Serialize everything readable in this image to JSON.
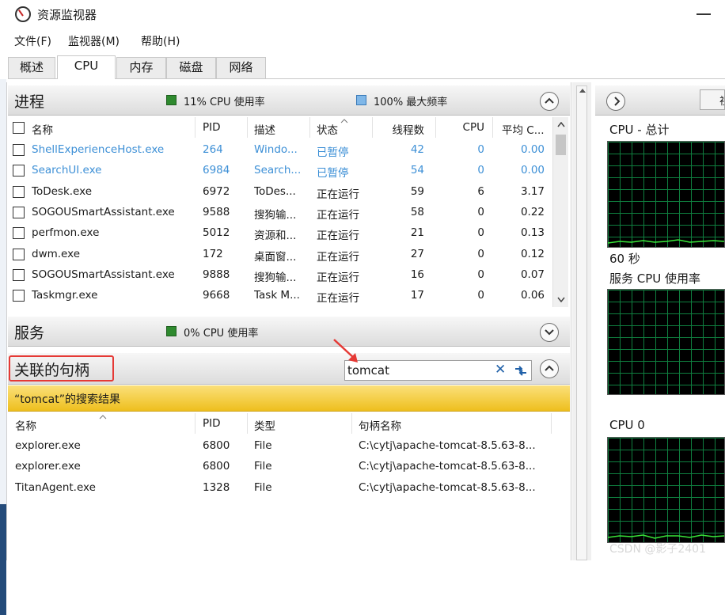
{
  "app": {
    "title": "资源监视器",
    "icon": "resource-monitor-icon"
  },
  "menu": [
    "文件(F)",
    "监视器(M)",
    "帮助(H)"
  ],
  "tabs": [
    "概述",
    "CPU",
    "内存",
    "磁盘",
    "网络"
  ],
  "active_tab": "CPU",
  "processes": {
    "title": "进程",
    "cpu_usage": "11% CPU 使用率",
    "max_freq": "100% 最大频率",
    "columns": [
      "名称",
      "PID",
      "描述",
      "状态",
      "线程数",
      "CPU",
      "平均 C..."
    ],
    "rows": [
      {
        "name": "ShellExperienceHost.exe",
        "pid": "264",
        "desc": "Windo...",
        "status": "已暂停",
        "threads": "42",
        "cpu": "0",
        "avg": "0.00"
      },
      {
        "name": "SearchUI.exe",
        "pid": "6984",
        "desc": "Search...",
        "status": "已暂停",
        "threads": "54",
        "cpu": "0",
        "avg": "0.00"
      },
      {
        "name": "ToDesk.exe",
        "pid": "6972",
        "desc": "ToDes...",
        "status": "正在运行",
        "threads": "59",
        "cpu": "6",
        "avg": "3.17"
      },
      {
        "name": "SOGOUSmartAssistant.exe",
        "pid": "9588",
        "desc": "搜狗输...",
        "status": "正在运行",
        "threads": "58",
        "cpu": "0",
        "avg": "0.22"
      },
      {
        "name": "perfmon.exe",
        "pid": "5012",
        "desc": "资源和...",
        "status": "正在运行",
        "threads": "21",
        "cpu": "0",
        "avg": "0.13"
      },
      {
        "name": "dwm.exe",
        "pid": "172",
        "desc": "桌面窗...",
        "status": "正在运行",
        "threads": "27",
        "cpu": "0",
        "avg": "0.12"
      },
      {
        "name": "SOGOUSmartAssistant.exe",
        "pid": "9888",
        "desc": "搜狗输...",
        "status": "正在运行",
        "threads": "16",
        "cpu": "0",
        "avg": "0.07"
      },
      {
        "name": "Taskmgr.exe",
        "pid": "9668",
        "desc": "Task M...",
        "status": "正在运行",
        "threads": "17",
        "cpu": "0",
        "avg": "0.06"
      }
    ]
  },
  "services": {
    "title": "服务",
    "cpu_usage": "0% CPU 使用率"
  },
  "handles": {
    "title": "关联的句柄",
    "search_value": "tomcat",
    "result_label": "“tomcat”的搜索结果",
    "columns": [
      "名称",
      "PID",
      "类型",
      "句柄名称"
    ],
    "rows": [
      {
        "name": "explorer.exe",
        "pid": "6800",
        "type": "File",
        "handle": "C:\\cytj\\apache-tomcat-8.5.63-8..."
      },
      {
        "name": "explorer.exe",
        "pid": "6800",
        "type": "File",
        "handle": "C:\\cytj\\apache-tomcat-8.5.63-8..."
      },
      {
        "name": "TitanAgent.exe",
        "pid": "1328",
        "type": "File",
        "handle": "C:\\cytj\\apache-tomcat-8.5.63-8..."
      }
    ]
  },
  "right_panel": {
    "cpu_total": "CPU - 总计",
    "duration": "60 秒",
    "service_cpu": "服务 CPU 使用率",
    "cpu0": "CPU 0",
    "view_button": "视"
  },
  "watermark": "CSDN @影子2401",
  "colors": {
    "suspended": "#3c8fd6",
    "highlight": "#eebf1e",
    "annotation": "#e53935",
    "graph_grid": "#0f7f3f",
    "graph_line": "#39e639"
  }
}
